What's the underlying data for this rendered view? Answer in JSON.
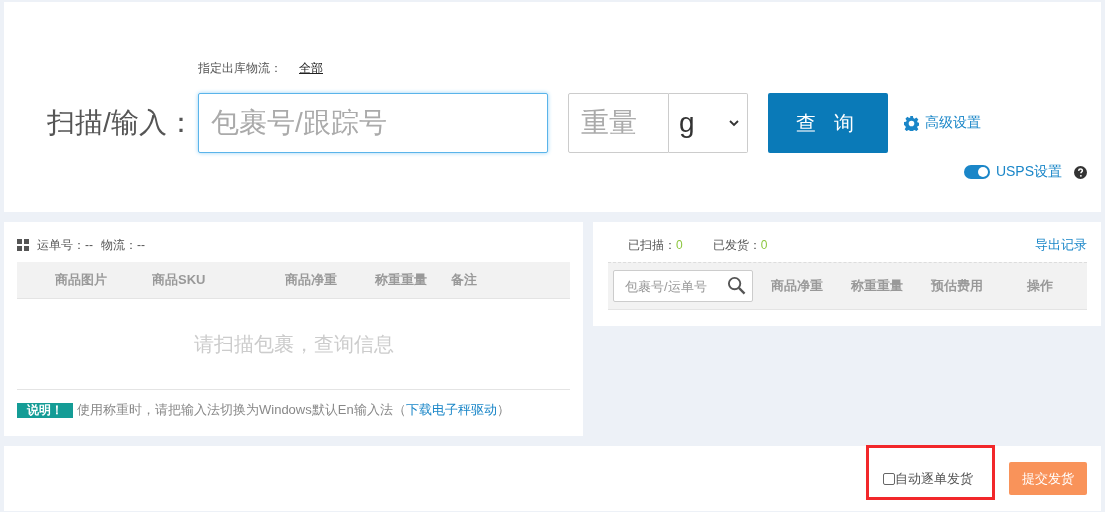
{
  "top": {
    "logistics_label": "指定出库物流：",
    "logistics_value": "全部",
    "scan_label": "扫描/输入：",
    "scan_placeholder": "包裹号/跟踪号",
    "weight_placeholder": "重量",
    "unit": "g",
    "query_button": "查 询",
    "advanced_link": "高级设置",
    "usps": {
      "label": "USPS设置",
      "on": true
    }
  },
  "package_panel": {
    "waybill": "运单号：--",
    "logistics": "物流：--",
    "columns": [
      "商品图片",
      "商品SKU",
      "商品净重",
      "称重重量",
      "备注"
    ],
    "empty_message": "请扫描包裹，查询信息",
    "note_badge": "说明！",
    "note": "使用称重时，请把输入法切换为Windows默认En输入法（",
    "note_link": "下载电子秤驱动",
    "note_end": "）"
  },
  "record_panel": {
    "scanned_label": "已扫描：",
    "scanned": "0",
    "shipped_label": "已发货：",
    "shipped": "0",
    "export_link": "导出记录",
    "search_placeholder": "包裹号/运单号",
    "columns": [
      "商品净重",
      "称重重量",
      "预估费用",
      "操作"
    ]
  },
  "footer": {
    "auto_ship": {
      "label": "自动逐单发货",
      "checked": false
    },
    "submit_button": "提交发货"
  }
}
